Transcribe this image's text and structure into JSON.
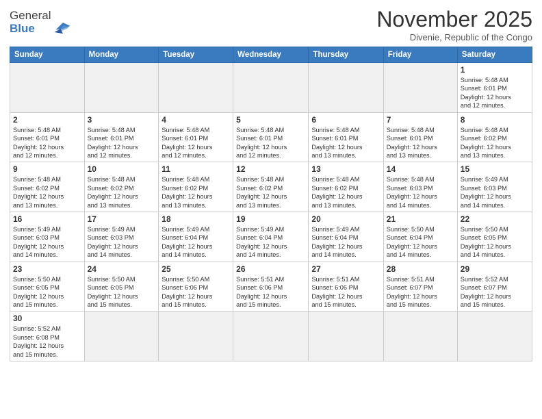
{
  "header": {
    "logo_general": "General",
    "logo_blue": "Blue",
    "month_title": "November 2025",
    "subtitle": "Divenie, Republic of the Congo"
  },
  "weekdays": [
    "Sunday",
    "Monday",
    "Tuesday",
    "Wednesday",
    "Thursday",
    "Friday",
    "Saturday"
  ],
  "weeks": [
    [
      {
        "day": "",
        "info": ""
      },
      {
        "day": "",
        "info": ""
      },
      {
        "day": "",
        "info": ""
      },
      {
        "day": "",
        "info": ""
      },
      {
        "day": "",
        "info": ""
      },
      {
        "day": "",
        "info": ""
      },
      {
        "day": "1",
        "info": "Sunrise: 5:48 AM\nSunset: 6:01 PM\nDaylight: 12 hours\nand 12 minutes."
      }
    ],
    [
      {
        "day": "2",
        "info": "Sunrise: 5:48 AM\nSunset: 6:01 PM\nDaylight: 12 hours\nand 12 minutes."
      },
      {
        "day": "3",
        "info": "Sunrise: 5:48 AM\nSunset: 6:01 PM\nDaylight: 12 hours\nand 12 minutes."
      },
      {
        "day": "4",
        "info": "Sunrise: 5:48 AM\nSunset: 6:01 PM\nDaylight: 12 hours\nand 12 minutes."
      },
      {
        "day": "5",
        "info": "Sunrise: 5:48 AM\nSunset: 6:01 PM\nDaylight: 12 hours\nand 12 minutes."
      },
      {
        "day": "6",
        "info": "Sunrise: 5:48 AM\nSunset: 6:01 PM\nDaylight: 12 hours\nand 13 minutes."
      },
      {
        "day": "7",
        "info": "Sunrise: 5:48 AM\nSunset: 6:01 PM\nDaylight: 12 hours\nand 13 minutes."
      },
      {
        "day": "8",
        "info": "Sunrise: 5:48 AM\nSunset: 6:02 PM\nDaylight: 12 hours\nand 13 minutes."
      }
    ],
    [
      {
        "day": "9",
        "info": "Sunrise: 5:48 AM\nSunset: 6:02 PM\nDaylight: 12 hours\nand 13 minutes."
      },
      {
        "day": "10",
        "info": "Sunrise: 5:48 AM\nSunset: 6:02 PM\nDaylight: 12 hours\nand 13 minutes."
      },
      {
        "day": "11",
        "info": "Sunrise: 5:48 AM\nSunset: 6:02 PM\nDaylight: 12 hours\nand 13 minutes."
      },
      {
        "day": "12",
        "info": "Sunrise: 5:48 AM\nSunset: 6:02 PM\nDaylight: 12 hours\nand 13 minutes."
      },
      {
        "day": "13",
        "info": "Sunrise: 5:48 AM\nSunset: 6:02 PM\nDaylight: 12 hours\nand 13 minutes."
      },
      {
        "day": "14",
        "info": "Sunrise: 5:48 AM\nSunset: 6:03 PM\nDaylight: 12 hours\nand 14 minutes."
      },
      {
        "day": "15",
        "info": "Sunrise: 5:49 AM\nSunset: 6:03 PM\nDaylight: 12 hours\nand 14 minutes."
      }
    ],
    [
      {
        "day": "16",
        "info": "Sunrise: 5:49 AM\nSunset: 6:03 PM\nDaylight: 12 hours\nand 14 minutes."
      },
      {
        "day": "17",
        "info": "Sunrise: 5:49 AM\nSunset: 6:03 PM\nDaylight: 12 hours\nand 14 minutes."
      },
      {
        "day": "18",
        "info": "Sunrise: 5:49 AM\nSunset: 6:04 PM\nDaylight: 12 hours\nand 14 minutes."
      },
      {
        "day": "19",
        "info": "Sunrise: 5:49 AM\nSunset: 6:04 PM\nDaylight: 12 hours\nand 14 minutes."
      },
      {
        "day": "20",
        "info": "Sunrise: 5:49 AM\nSunset: 6:04 PM\nDaylight: 12 hours\nand 14 minutes."
      },
      {
        "day": "21",
        "info": "Sunrise: 5:50 AM\nSunset: 6:04 PM\nDaylight: 12 hours\nand 14 minutes."
      },
      {
        "day": "22",
        "info": "Sunrise: 5:50 AM\nSunset: 6:05 PM\nDaylight: 12 hours\nand 14 minutes."
      }
    ],
    [
      {
        "day": "23",
        "info": "Sunrise: 5:50 AM\nSunset: 6:05 PM\nDaylight: 12 hours\nand 15 minutes."
      },
      {
        "day": "24",
        "info": "Sunrise: 5:50 AM\nSunset: 6:05 PM\nDaylight: 12 hours\nand 15 minutes."
      },
      {
        "day": "25",
        "info": "Sunrise: 5:50 AM\nSunset: 6:06 PM\nDaylight: 12 hours\nand 15 minutes."
      },
      {
        "day": "26",
        "info": "Sunrise: 5:51 AM\nSunset: 6:06 PM\nDaylight: 12 hours\nand 15 minutes."
      },
      {
        "day": "27",
        "info": "Sunrise: 5:51 AM\nSunset: 6:06 PM\nDaylight: 12 hours\nand 15 minutes."
      },
      {
        "day": "28",
        "info": "Sunrise: 5:51 AM\nSunset: 6:07 PM\nDaylight: 12 hours\nand 15 minutes."
      },
      {
        "day": "29",
        "info": "Sunrise: 5:52 AM\nSunset: 6:07 PM\nDaylight: 12 hours\nand 15 minutes."
      }
    ],
    [
      {
        "day": "30",
        "info": "Sunrise: 5:52 AM\nSunset: 6:08 PM\nDaylight: 12 hours\nand 15 minutes."
      },
      {
        "day": "",
        "info": ""
      },
      {
        "day": "",
        "info": ""
      },
      {
        "day": "",
        "info": ""
      },
      {
        "day": "",
        "info": ""
      },
      {
        "day": "",
        "info": ""
      },
      {
        "day": "",
        "info": ""
      }
    ]
  ]
}
